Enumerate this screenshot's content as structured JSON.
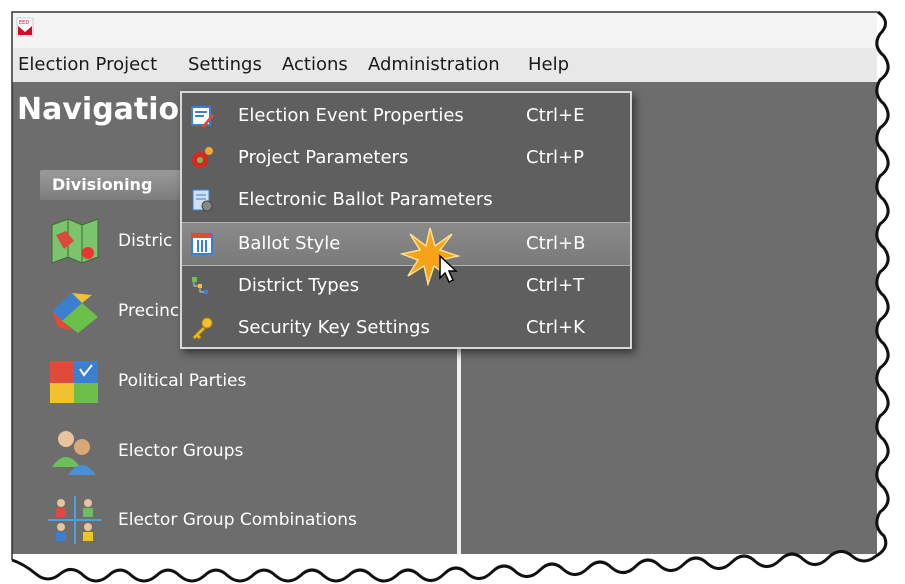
{
  "menubar": {
    "items": [
      "Election Project",
      "Settings",
      "Actions",
      "Administration",
      "Help"
    ]
  },
  "nav": {
    "title": "Navigatio",
    "tab_label": "Divisioning",
    "items": [
      {
        "label": "Distric",
        "icon": "district-map-icon"
      },
      {
        "label": "Precinc",
        "icon": "precinct-icon"
      },
      {
        "label": "Political Parties",
        "icon": "political-parties-icon"
      },
      {
        "label": "Elector Groups",
        "icon": "elector-groups-icon"
      },
      {
        "label": "Elector Group Combinations",
        "icon": "elector-group-combinations-icon"
      }
    ]
  },
  "settings_menu": {
    "items": [
      {
        "label": "Election Event Properties",
        "shortcut": "Ctrl+E",
        "icon": "properties-icon"
      },
      {
        "label": "Project Parameters",
        "shortcut": "Ctrl+P",
        "icon": "parameters-icon"
      },
      {
        "label": "Electronic Ballot Parameters",
        "shortcut": "",
        "icon": "electronic-ballot-icon"
      },
      {
        "label": "Ballot Style",
        "shortcut": "Ctrl+B",
        "icon": "ballot-style-icon"
      },
      {
        "label": "District Types",
        "shortcut": "Ctrl+T",
        "icon": "district-types-icon"
      },
      {
        "label": "Security Key Settings",
        "shortcut": "Ctrl+K",
        "icon": "key-icon"
      }
    ],
    "highlighted": "Ballot Style"
  },
  "colors": {
    "content_bg": "#6d6d6d",
    "menu_bg": "#5f5f5f",
    "highlight": "#808080",
    "menubar": "#e8e8e8"
  }
}
